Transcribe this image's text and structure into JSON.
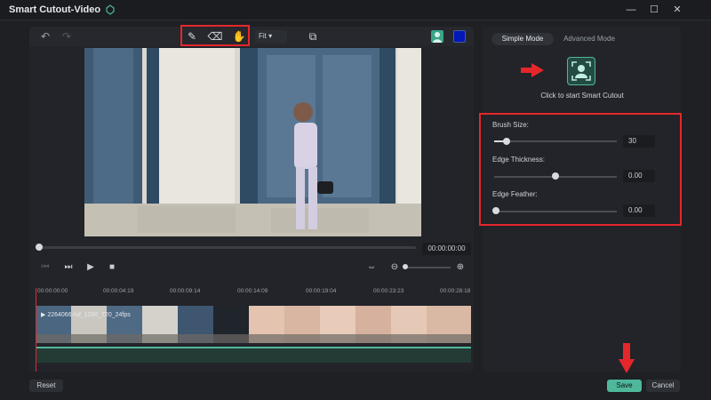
{
  "window": {
    "title": "Smart Cutout-Video",
    "minimize_icon": "minimize-icon",
    "maximize_icon": "maximize-icon",
    "close_icon": "close-icon"
  },
  "toolbar": {
    "fit_label": "Fit",
    "accent": "#4fb79b",
    "highlight": "#e5272c"
  },
  "player": {
    "timecode": "00:00:00:00"
  },
  "timeline": {
    "marks": [
      "00:00:00:00",
      "00:00:04:19",
      "00:00:09:14",
      "00:00:14:09",
      "00:00:19:04",
      "00:00:23:23",
      "00:00:28:18"
    ],
    "clip_name": "2264066-hd_1280_720_24fps"
  },
  "panel": {
    "tab_simple": "Simple Mode",
    "tab_advanced": "Advanced Mode",
    "hint": "Click to start Smart Cutout",
    "brush_size_label": "Brush Size:",
    "brush_size_value": "30",
    "edge_thickness_label": "Edge Thickness:",
    "edge_thickness_value": "0.00",
    "edge_feather_label": "Edge Feather:",
    "edge_feather_value": "0.00"
  },
  "footer": {
    "reset": "Reset",
    "save": "Save",
    "cancel": "Cancel"
  }
}
